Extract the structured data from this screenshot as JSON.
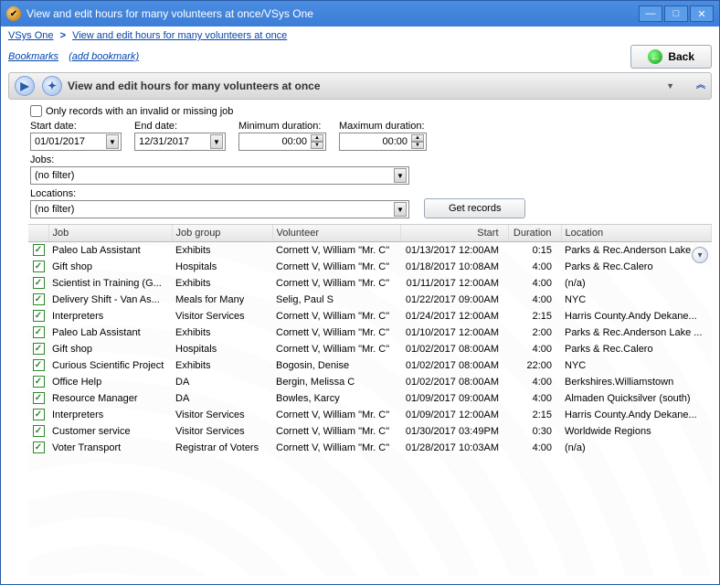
{
  "window": {
    "title": "View and edit hours for many volunteers at once/VSys One"
  },
  "breadcrumb": {
    "root": "VSys One",
    "current": "View and edit hours for many volunteers at once"
  },
  "links": {
    "bookmarks": "Bookmarks",
    "add_bookmark": "(add bookmark)"
  },
  "back_label": "Back",
  "panel_title": "View and edit hours for many volunteers at once",
  "filters": {
    "invalid_job_label": "Only records with an invalid or missing job",
    "start_date_label": "Start date:",
    "start_date": "01/01/2017",
    "end_date_label": "End date:",
    "end_date": "12/31/2017",
    "min_dur_label": "Minimum duration:",
    "min_dur": "00:00",
    "max_dur_label": "Maximum duration:",
    "max_dur": "00:00",
    "jobs_label": "Jobs:",
    "jobs_value": "(no filter)",
    "locations_label": "Locations:",
    "locations_value": "(no filter)",
    "get_records": "Get records"
  },
  "columns": {
    "job": "Job",
    "job_group": "Job group",
    "volunteer": "Volunteer",
    "start": "Start",
    "duration": "Duration",
    "location": "Location"
  },
  "rows": [
    {
      "job": "Paleo Lab Assistant",
      "group": "Exhibits",
      "vol": "Cornett V, William \"Mr. C\"",
      "start": "01/13/2017 12:00AM",
      "dur": "0:15",
      "loc": "Parks & Rec.Anderson Lake ..."
    },
    {
      "job": "Gift shop",
      "group": "Hospitals",
      "vol": "Cornett V, William \"Mr. C\"",
      "start": "01/18/2017 10:08AM",
      "dur": "4:00",
      "loc": "Parks & Rec.Calero"
    },
    {
      "job": "Scientist in Training (G...",
      "group": "Exhibits",
      "vol": "Cornett V, William \"Mr. C\"",
      "start": "01/11/2017 12:00AM",
      "dur": "4:00",
      "loc": "(n/a)"
    },
    {
      "job": "Delivery Shift - Van As...",
      "group": "Meals for Many",
      "vol": "Selig, Paul S",
      "start": "01/22/2017 09:00AM",
      "dur": "4:00",
      "loc": "NYC"
    },
    {
      "job": "Interpreters",
      "group": "Visitor Services",
      "vol": "Cornett V, William \"Mr. C\"",
      "start": "01/24/2017 12:00AM",
      "dur": "2:15",
      "loc": "Harris County.Andy Dekane..."
    },
    {
      "job": "Paleo Lab Assistant",
      "group": "Exhibits",
      "vol": "Cornett V, William \"Mr. C\"",
      "start": "01/10/2017 12:00AM",
      "dur": "2:00",
      "loc": "Parks & Rec.Anderson Lake ..."
    },
    {
      "job": "Gift shop",
      "group": "Hospitals",
      "vol": "Cornett V, William \"Mr. C\"",
      "start": "01/02/2017 08:00AM",
      "dur": "4:00",
      "loc": "Parks & Rec.Calero"
    },
    {
      "job": "Curious Scientific Project",
      "group": "Exhibits",
      "vol": "Bogosin, Denise",
      "start": "01/02/2017 08:00AM",
      "dur": "22:00",
      "loc": "NYC"
    },
    {
      "job": "Office Help",
      "group": "DA",
      "vol": "Bergin, Melissa C",
      "start": "01/02/2017 08:00AM",
      "dur": "4:00",
      "loc": "Berkshires.Williamstown"
    },
    {
      "job": "Resource Manager",
      "group": "DA",
      "vol": "Bowles, Karcy",
      "start": "01/09/2017 09:00AM",
      "dur": "4:00",
      "loc": "Almaden Quicksilver (south)"
    },
    {
      "job": "Interpreters",
      "group": "Visitor Services",
      "vol": "Cornett V, William \"Mr. C\"",
      "start": "01/09/2017 12:00AM",
      "dur": "2:15",
      "loc": "Harris County.Andy Dekane..."
    },
    {
      "job": "Customer service",
      "group": "Visitor Services",
      "vol": "Cornett V, William \"Mr. C\"",
      "start": "01/30/2017 03:49PM",
      "dur": "0:30",
      "loc": "Worldwide Regions"
    },
    {
      "job": "Voter Transport",
      "group": "Registrar of Voters",
      "vol": "Cornett V, William \"Mr. C\"",
      "start": "01/28/2017 10:03AM",
      "dur": "4:00",
      "loc": "(n/a)"
    }
  ]
}
